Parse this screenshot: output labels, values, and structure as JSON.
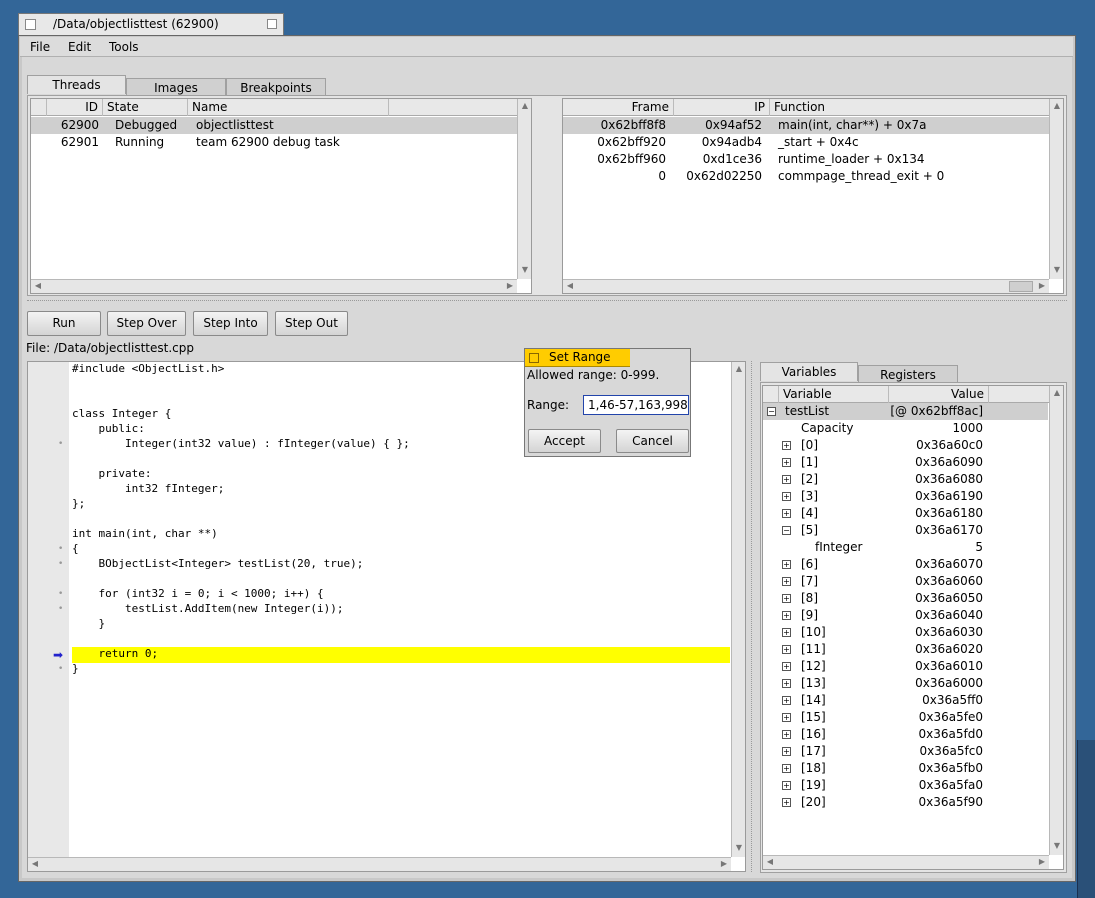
{
  "window": {
    "title": "/Data/objectlisttest (62900)"
  },
  "menu": [
    "File",
    "Edit",
    "Tools"
  ],
  "tabs": [
    "Threads",
    "Images",
    "Breakpoints"
  ],
  "threads": {
    "columns": [
      "ID",
      "State",
      "Name"
    ],
    "rows": [
      {
        "id": "62900",
        "state": "Debugged",
        "name": "objectlisttest"
      },
      {
        "id": "62901",
        "state": "Running",
        "name": "team 62900 debug task"
      }
    ]
  },
  "stack": {
    "columns": [
      "Frame",
      "IP",
      "Function"
    ],
    "rows": [
      {
        "frame": "0x62bff8f8",
        "ip": "0x94af52",
        "func": "main(int, char**) + 0x7a"
      },
      {
        "frame": "0x62bff920",
        "ip": "0x94adb4",
        "func": "_start + 0x4c"
      },
      {
        "frame": "0x62bff960",
        "ip": "0xd1ce36",
        "func": "runtime_loader + 0x134"
      },
      {
        "frame": "0",
        "ip": "0x62d02250",
        "func": "commpage_thread_exit + 0"
      }
    ]
  },
  "toolbar": {
    "run": "Run",
    "step_over": "Step Over",
    "step_into": "Step Into",
    "step_out": "Step Out"
  },
  "file_label": "File: /Data/objectlisttest.cpp",
  "source": [
    "#include <ObjectList.h>",
    "",
    "",
    "class Integer {",
    "    public:",
    "        Integer(int32 value) : fInteger(value) { };",
    "",
    "    private:",
    "        int32 fInteger;",
    "};",
    "",
    "int main(int, char **)",
    "{",
    "    BObjectList<Integer> testList(20, true);",
    "",
    "    for (int32 i = 0; i < 1000; i++) {",
    "        testList.AddItem(new Integer(i));",
    "    }",
    "",
    "    return 0;",
    "}"
  ],
  "dialog": {
    "title": "Set Range",
    "allowed": "Allowed range: 0-999.",
    "range_label": "Range:",
    "range_value": "1,46-57,163,998",
    "accept": "Accept",
    "cancel": "Cancel"
  },
  "var_tabs": [
    "Variables",
    "Registers"
  ],
  "variables": {
    "columns": [
      "Variable",
      "Value"
    ],
    "root": {
      "name": "testList",
      "value": "[@ 0x62bff8ac]"
    },
    "capacity": {
      "name": "Capacity",
      "value": "1000"
    },
    "items": [
      {
        "name": "[0]",
        "value": "0x36a60c0"
      },
      {
        "name": "[1]",
        "value": "0x36a6090"
      },
      {
        "name": "[2]",
        "value": "0x36a6080"
      },
      {
        "name": "[3]",
        "value": "0x36a6190"
      },
      {
        "name": "[4]",
        "value": "0x36a6180"
      },
      {
        "name": "[5]",
        "value": "0x36a6170"
      },
      {
        "name": "[6]",
        "value": "0x36a6070"
      },
      {
        "name": "[7]",
        "value": "0x36a6060"
      },
      {
        "name": "[8]",
        "value": "0x36a6050"
      },
      {
        "name": "[9]",
        "value": "0x36a6040"
      },
      {
        "name": "[10]",
        "value": "0x36a6030"
      },
      {
        "name": "[11]",
        "value": "0x36a6020"
      },
      {
        "name": "[12]",
        "value": "0x36a6010"
      },
      {
        "name": "[13]",
        "value": "0x36a6000"
      },
      {
        "name": "[14]",
        "value": "0x36a5ff0"
      },
      {
        "name": "[15]",
        "value": "0x36a5fe0"
      },
      {
        "name": "[16]",
        "value": "0x36a5fd0"
      },
      {
        "name": "[17]",
        "value": "0x36a5fc0"
      },
      {
        "name": "[18]",
        "value": "0x36a5fb0"
      },
      {
        "name": "[19]",
        "value": "0x36a5fa0"
      },
      {
        "name": "[20]",
        "value": "0x36a5f90"
      }
    ],
    "child": {
      "name": "fInteger",
      "value": "5"
    }
  },
  "colors": {
    "desktop": "#336698",
    "highlight": "#ffff00",
    "dialog_title": "#ffcc00",
    "pc_arrow": "#2222cc"
  }
}
